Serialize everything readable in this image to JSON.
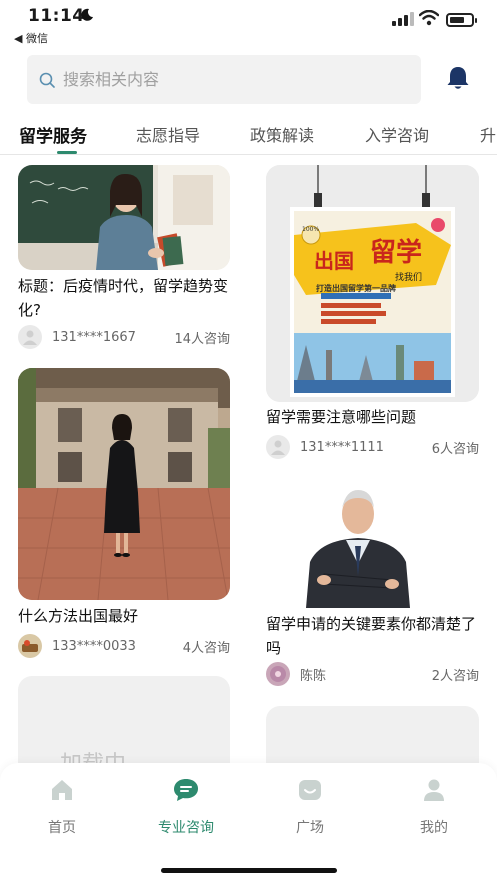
{
  "status": {
    "time": "11:14",
    "back_app": "◀ 微信"
  },
  "search": {
    "placeholder": "搜索相关内容"
  },
  "tabs": [
    {
      "label": "留学服务",
      "active": true
    },
    {
      "label": "志愿指导",
      "active": false
    },
    {
      "label": "政策解读",
      "active": false
    },
    {
      "label": "入学咨询",
      "active": false
    },
    {
      "label": "升",
      "active": false
    }
  ],
  "cards": [
    {
      "title": "标题：后疫情时代，留学趋势变化?",
      "user": "131****1667",
      "count": "14人咨询"
    },
    {
      "title": "留学需要注意哪些问题",
      "user": "131****1111",
      "count": "6人咨询"
    },
    {
      "title": "什么方法出国最好",
      "user": "133****0033",
      "count": "4人咨询"
    },
    {
      "title": "留学申请的关键要素你都清楚了吗",
      "user": "陈陈",
      "count": "2人咨询"
    }
  ],
  "poster": {
    "badge": "100%",
    "title_left": "出国",
    "title_right": "留学",
    "tag": "找我们",
    "slogan": "打造出国留学第一品牌"
  },
  "loading": "加载中",
  "nav": [
    {
      "label": "首页",
      "icon": "home-icon",
      "active": false
    },
    {
      "label": "专业咨询",
      "icon": "chat-icon",
      "active": true
    },
    {
      "label": "广场",
      "icon": "smile-icon",
      "active": false
    },
    {
      "label": "我的",
      "icon": "user-icon",
      "active": false
    }
  ],
  "colors": {
    "accent": "#2d8a6e",
    "bell": "#1c3566"
  }
}
